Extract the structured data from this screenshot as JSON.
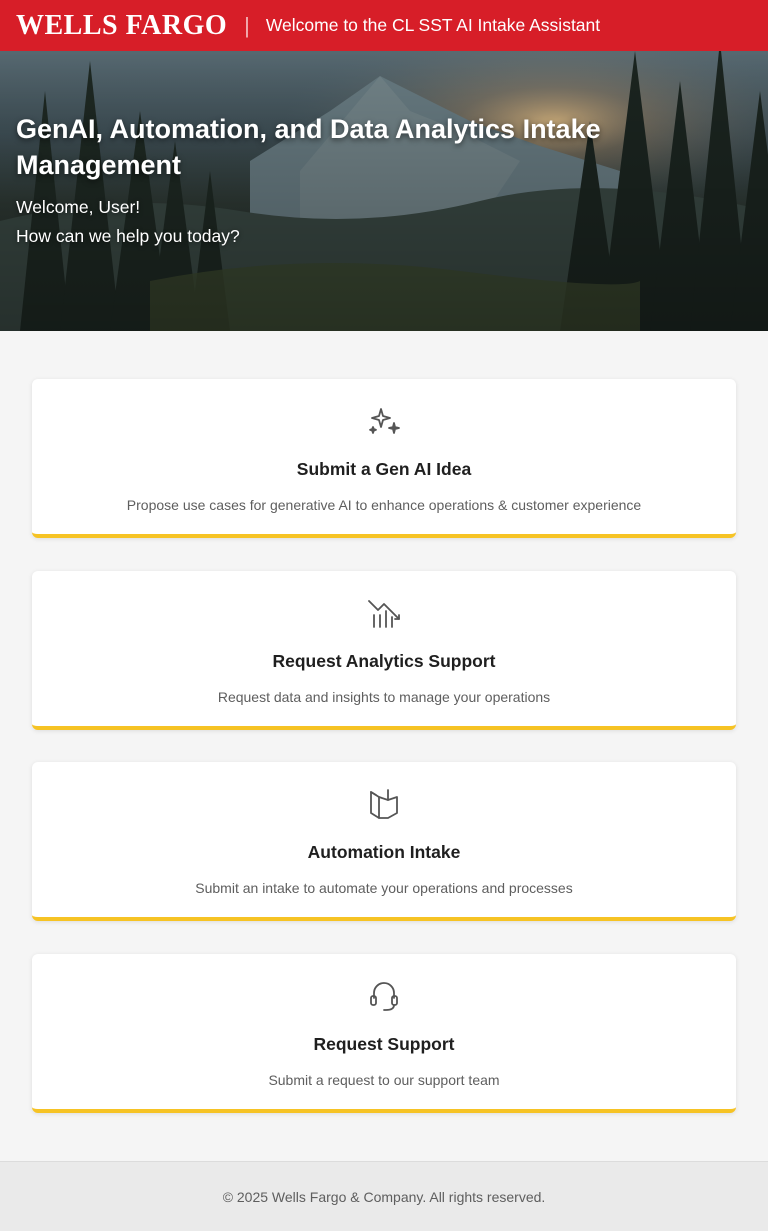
{
  "header": {
    "brand": "WELLS FARGO",
    "separator": "|",
    "title": "Welcome to the CL SST AI Intake Assistant",
    "brand_color": "#d71e28"
  },
  "hero": {
    "title": "GenAI, Automation, and Data Analytics Intake Management",
    "welcome": "Welcome, User!",
    "prompt": "How can we help you today?"
  },
  "cards": [
    {
      "icon": "sparkles-icon",
      "title": "Submit a Gen AI Idea",
      "description": "Propose use cases for generative AI to enhance operations & customer experience"
    },
    {
      "icon": "analytics-chart-icon",
      "title": "Request Analytics Support",
      "description": "Request data and insights to manage your operations"
    },
    {
      "icon": "automation-flag-icon",
      "title": "Automation Intake",
      "description": "Submit an intake to automate your operations and processes"
    },
    {
      "icon": "headset-icon",
      "title": "Request Support",
      "description": "Submit a request to our support team"
    }
  ],
  "accent_color": "#f6c324",
  "footer": {
    "copyright": "© 2025 Wells Fargo & Company. All rights reserved."
  }
}
